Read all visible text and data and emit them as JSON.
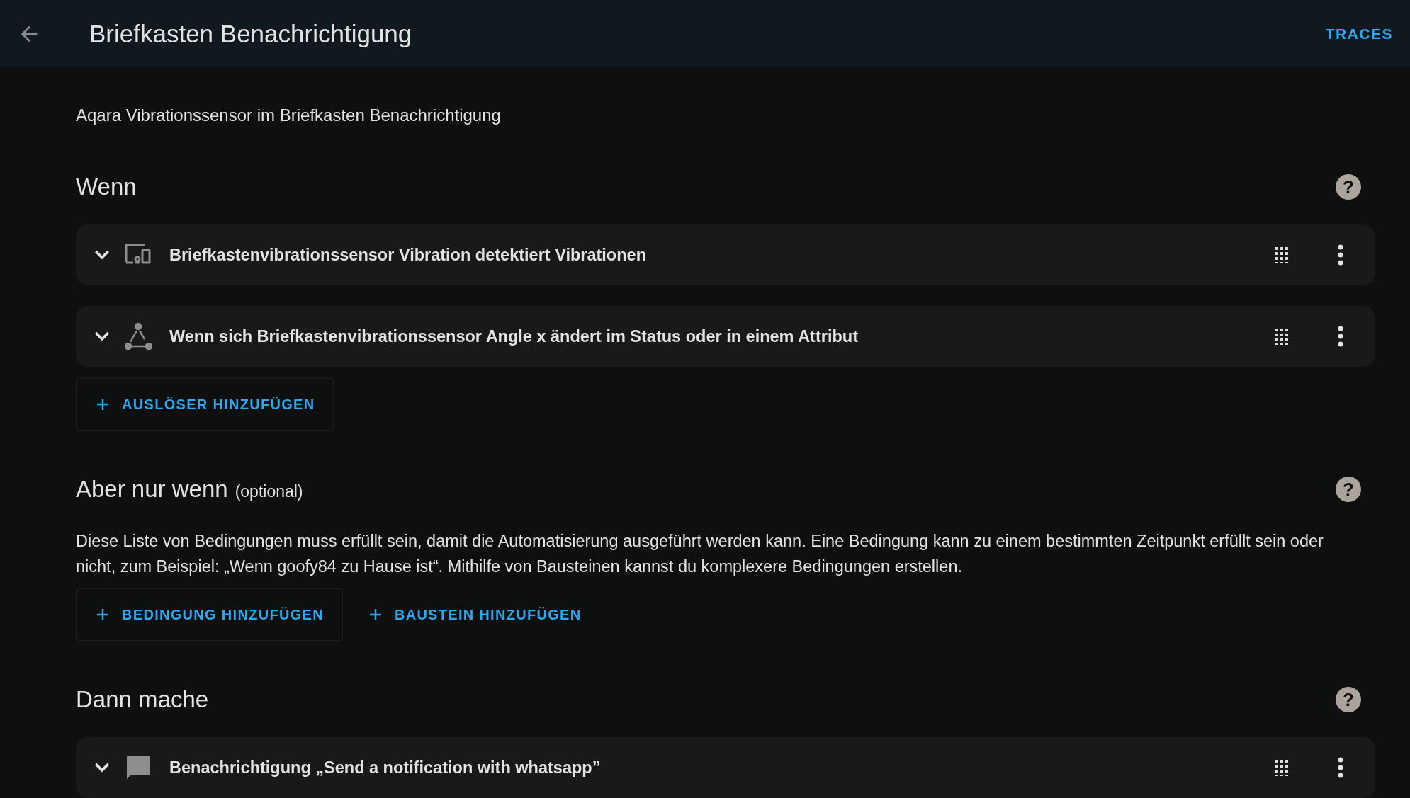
{
  "header": {
    "title": "Briefkasten Benachrichtigung",
    "action": "TRACES"
  },
  "description": "Aqara Vibrationssensor im Briefkasten Benachrichtigung",
  "sections": [
    {
      "title": "Wenn",
      "help": "?",
      "items": [
        {
          "kind": "device",
          "text": "Briefkastenvibrationssensor Vibration detektiert Vibrationen"
        },
        {
          "kind": "state",
          "text": "Wenn sich Briefkastenvibrationssensor Angle x ändert im Status oder in einem Attribut"
        }
      ],
      "buttons": [
        {
          "label": "AUSLÖSER HINZUFÜGEN",
          "outlined": true
        }
      ]
    },
    {
      "title": "Aber nur wenn",
      "hint": "(optional)",
      "help": "?",
      "paragraph": "Diese Liste von Bedingungen muss erfüllt sein, damit die Automatisierung ausgeführt werden kann. Eine Bedingung kann zu einem bestimmten Zeitpunkt erfüllt sein oder nicht, zum Beispiel: „Wenn goofy84 zu Hause ist“. Mithilfe von Bausteinen kannst du komplexere Bedingungen erstellen.",
      "buttons": [
        {
          "label": "BEDINGUNG HINZUFÜGEN",
          "outlined": true
        },
        {
          "label": "BAUSTEIN HINZUFÜGEN",
          "outlined": false
        }
      ]
    },
    {
      "title": "Dann mache",
      "help": "?",
      "items": [
        {
          "kind": "notify",
          "text": "Benachrichtigung „Send a notification with whatsapp”"
        }
      ]
    }
  ]
}
